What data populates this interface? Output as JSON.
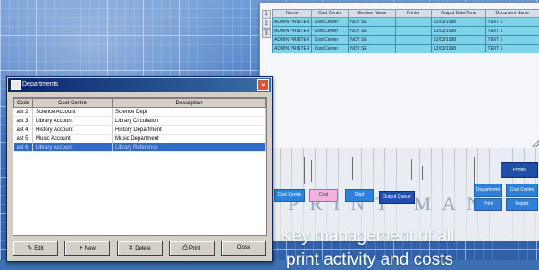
{
  "back_window": {
    "columns": [
      "Name",
      "Cost Centre",
      "Member Name",
      "Printer",
      "Output Date/Time",
      "Document Name"
    ],
    "rows": [
      [
        "ADMIN PRINTER",
        "Cost Center",
        "NOT SE",
        "",
        "12/03/1998",
        "TEXT 1"
      ],
      [
        "ADMIN PRINTER",
        "Cost Center",
        "NOT SE",
        "",
        "12/03/1998",
        "TEXT 1"
      ],
      [
        "ADMIN PRINTER",
        "Cost Center",
        "NOT SE",
        "",
        "12/03/1998",
        "TEXT 1"
      ],
      [
        "ADMIN PRINTER",
        "Cost Center",
        "NOT SE",
        "",
        "12/03/1998",
        "TEXT 1"
      ]
    ],
    "row_headers": [
      "1",
      "2",
      "3"
    ]
  },
  "diagram": {
    "letters": "PRINT MAN",
    "boxes": {
      "top_right": "Printer",
      "mid_left": "Cost Centre",
      "pink": "Cost",
      "mid_center": "Dept",
      "dark_center": "Output Queue",
      "right_1": "Department",
      "right_2": "Cost Centre",
      "right_3": "Print Manager",
      "right_4": "Report"
    }
  },
  "dialog": {
    "title": "Departments",
    "close_glyph": "×",
    "columns": [
      "Code",
      "Cost Centre",
      "Description"
    ],
    "rows": [
      [
        "ast 2",
        "Science Account",
        "Science Dept"
      ],
      [
        "ast 3",
        "Library Account",
        "Library Circulation"
      ],
      [
        "ast 4",
        "History Account",
        "History Department"
      ],
      [
        "ast 5",
        "Music Account",
        "Music Department"
      ],
      [
        "ast 6",
        "Library Account",
        "Library Reference"
      ]
    ],
    "selected_row": 4,
    "buttons": [
      {
        "glyph": "✎",
        "label": "Edit"
      },
      {
        "glyph": "+",
        "label": "New"
      },
      {
        "glyph": "✕",
        "label": "Delete"
      },
      {
        "glyph": "⎙",
        "label": "Print"
      },
      {
        "glyph": "",
        "label": "Close"
      }
    ]
  },
  "caption": {
    "line1": "Key management of all",
    "line2": "print activity and costs"
  }
}
